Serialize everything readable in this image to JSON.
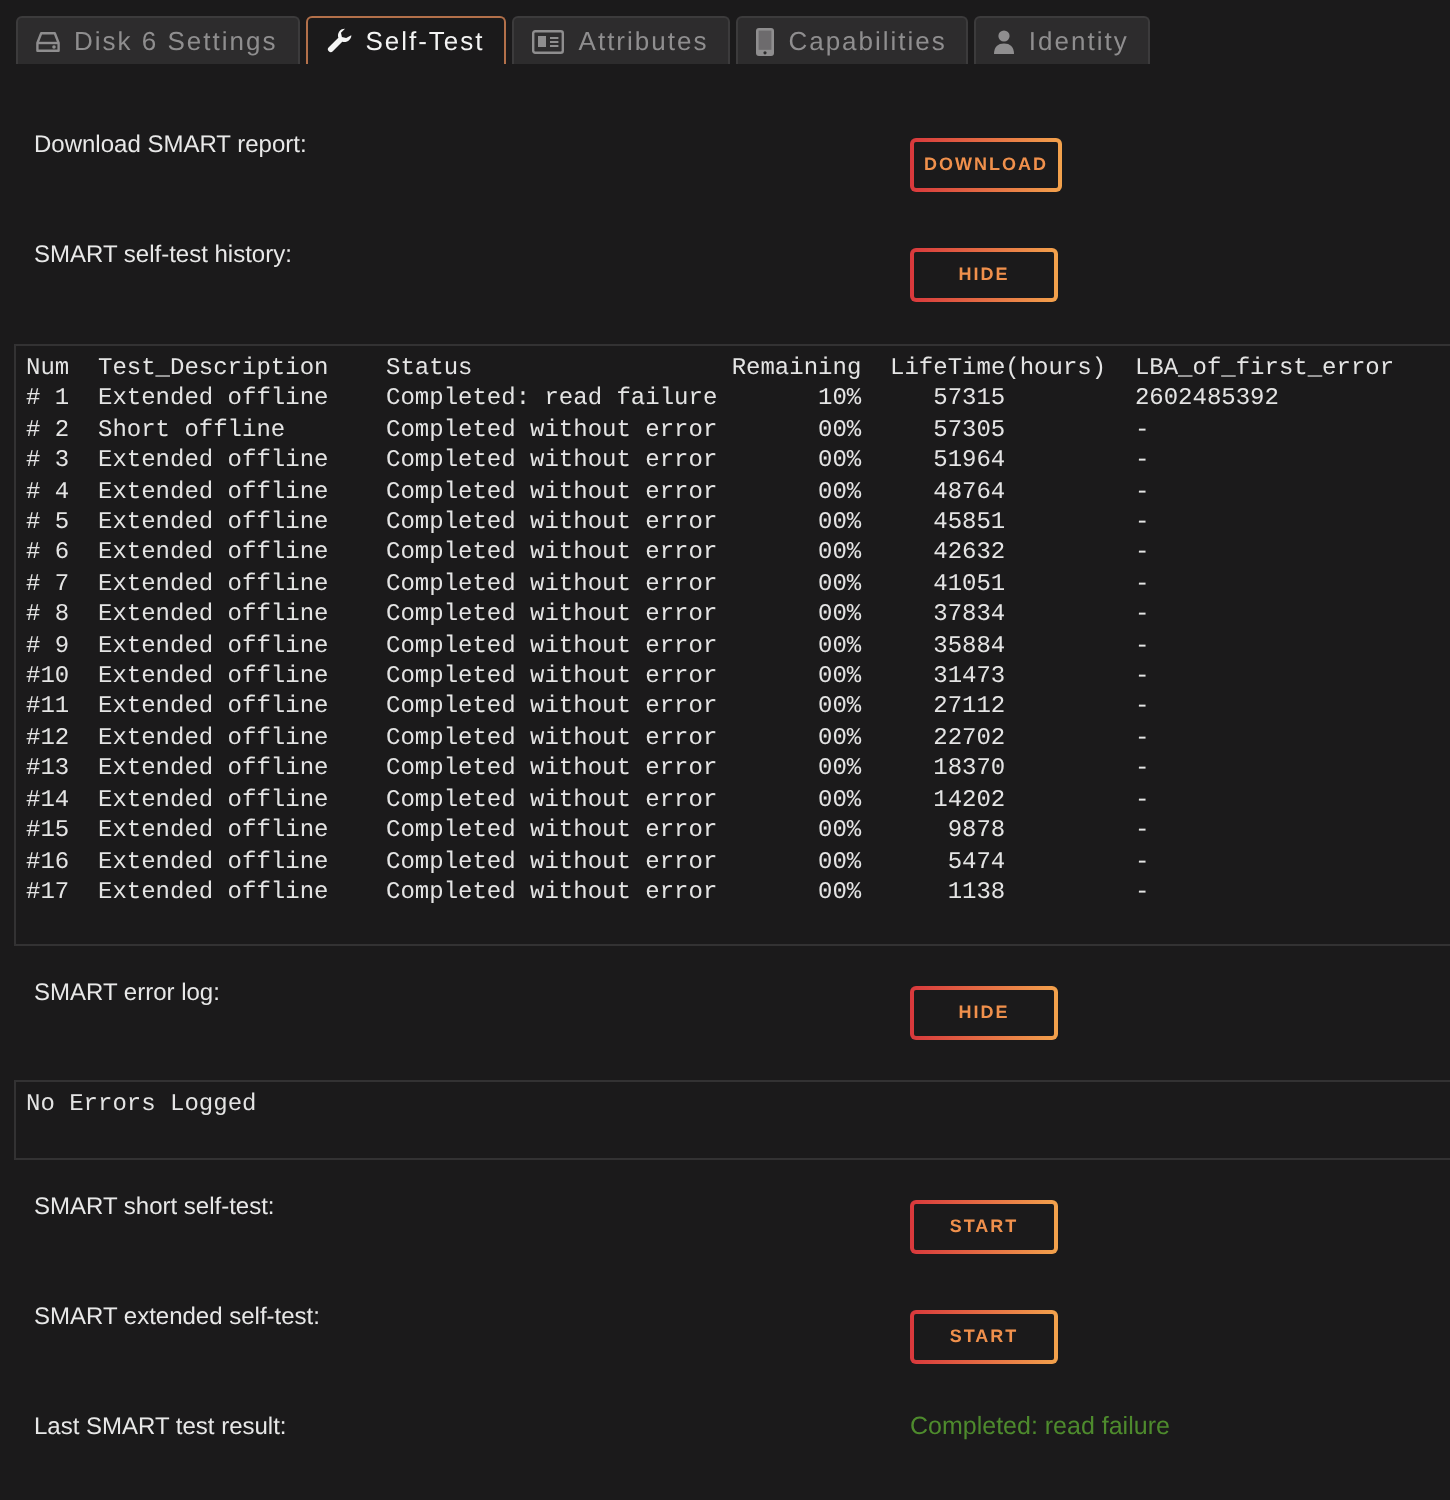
{
  "tabs": [
    {
      "label": "Disk 6 Settings",
      "selected": false
    },
    {
      "label": "Self-Test",
      "selected": true
    },
    {
      "label": "Attributes",
      "selected": false
    },
    {
      "label": "Capabilities",
      "selected": false
    },
    {
      "label": "Identity",
      "selected": false
    }
  ],
  "sections": [
    {
      "kind": "action",
      "label": "Download SMART report:",
      "button": "DOWNLOAD"
    },
    {
      "kind": "action",
      "label": "SMART self-test history:",
      "button": "HIDE"
    },
    {
      "kind": "table",
      "columns": [
        "Num",
        "Test_Description",
        "Status",
        "Remaining",
        "LifeTime(hours)",
        "LBA_of_first_error"
      ],
      "rows": [
        [
          "# 1",
          "Extended offline",
          "Completed: read failure",
          "10%",
          "57315",
          "2602485392"
        ],
        [
          "# 2",
          "Short offline",
          "Completed without error",
          "00%",
          "57305",
          "-"
        ],
        [
          "# 3",
          "Extended offline",
          "Completed without error",
          "00%",
          "51964",
          "-"
        ],
        [
          "# 4",
          "Extended offline",
          "Completed without error",
          "00%",
          "48764",
          "-"
        ],
        [
          "# 5",
          "Extended offline",
          "Completed without error",
          "00%",
          "45851",
          "-"
        ],
        [
          "# 6",
          "Extended offline",
          "Completed without error",
          "00%",
          "42632",
          "-"
        ],
        [
          "# 7",
          "Extended offline",
          "Completed without error",
          "00%",
          "41051",
          "-"
        ],
        [
          "# 8",
          "Extended offline",
          "Completed without error",
          "00%",
          "37834",
          "-"
        ],
        [
          "# 9",
          "Extended offline",
          "Completed without error",
          "00%",
          "35884",
          "-"
        ],
        [
          "#10",
          "Extended offline",
          "Completed without error",
          "00%",
          "31473",
          "-"
        ],
        [
          "#11",
          "Extended offline",
          "Completed without error",
          "00%",
          "27112",
          "-"
        ],
        [
          "#12",
          "Extended offline",
          "Completed without error",
          "00%",
          "22702",
          "-"
        ],
        [
          "#13",
          "Extended offline",
          "Completed without error",
          "00%",
          "18370",
          "-"
        ],
        [
          "#14",
          "Extended offline",
          "Completed without error",
          "00%",
          "14202",
          "-"
        ],
        [
          "#15",
          "Extended offline",
          "Completed without error",
          "00%",
          "9878",
          "-"
        ],
        [
          "#16",
          "Extended offline",
          "Completed without error",
          "00%",
          "5474",
          "-"
        ],
        [
          "#17",
          "Extended offline",
          "Completed without error",
          "00%",
          "1138",
          "-"
        ]
      ]
    },
    {
      "kind": "action",
      "label": "SMART error log:",
      "button": "HIDE"
    },
    {
      "kind": "message",
      "text": "No Errors Logged"
    },
    {
      "kind": "action",
      "label": "SMART short self-test:",
      "button": "START"
    },
    {
      "kind": "action",
      "label": "SMART extended self-test:",
      "button": "START"
    },
    {
      "kind": "result",
      "label": "Last SMART test result:",
      "value": "Completed: read failure"
    }
  ]
}
